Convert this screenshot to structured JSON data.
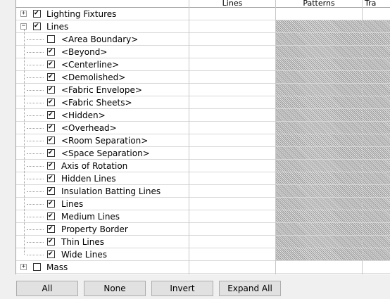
{
  "columns": {
    "lines": "Lines",
    "patterns": "Patterns",
    "trans": "Tra"
  },
  "rows": [
    {
      "label": "Lighting Fixtures",
      "level": 0,
      "checked": true,
      "expander": "+"
    },
    {
      "label": "Lines",
      "level": 0,
      "checked": true,
      "expander": "−"
    },
    {
      "label": "<Area Boundary>",
      "level": 1,
      "checked": false
    },
    {
      "label": "<Beyond>",
      "level": 1,
      "checked": true
    },
    {
      "label": "<Centerline>",
      "level": 1,
      "checked": true
    },
    {
      "label": "<Demolished>",
      "level": 1,
      "checked": true
    },
    {
      "label": "<Fabric Envelope>",
      "level": 1,
      "checked": true
    },
    {
      "label": "<Fabric Sheets>",
      "level": 1,
      "checked": true
    },
    {
      "label": "<Hidden>",
      "level": 1,
      "checked": true
    },
    {
      "label": "<Overhead>",
      "level": 1,
      "checked": true
    },
    {
      "label": "<Room Separation>",
      "level": 1,
      "checked": true
    },
    {
      "label": "<Space Separation>",
      "level": 1,
      "checked": true
    },
    {
      "label": "Axis of Rotation",
      "level": 1,
      "checked": true
    },
    {
      "label": "Hidden Lines",
      "level": 1,
      "checked": true
    },
    {
      "label": "Insulation Batting Lines",
      "level": 1,
      "checked": true
    },
    {
      "label": "Lines",
      "level": 1,
      "checked": true
    },
    {
      "label": "Medium Lines",
      "level": 1,
      "checked": true
    },
    {
      "label": "Property Border",
      "level": 1,
      "checked": true
    },
    {
      "label": "Thin Lines",
      "level": 1,
      "checked": true
    },
    {
      "label": "Wide Lines",
      "level": 1,
      "checked": true
    },
    {
      "label": "Mass",
      "level": 0,
      "checked": false,
      "expander": "+"
    }
  ],
  "buttons": {
    "all": "All",
    "none": "None",
    "invert": "Invert",
    "expand_all": "Expand All"
  },
  "colors": {
    "hatch": "#9a9a9a",
    "grid_line": "#c8c8c8",
    "button_bg": "#e1e1e1"
  }
}
